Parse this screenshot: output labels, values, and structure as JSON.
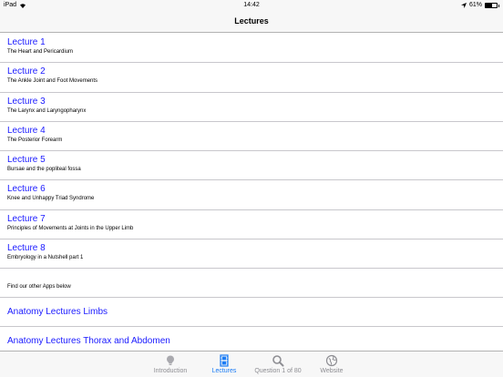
{
  "status": {
    "device": "iPad",
    "time": "14:42",
    "battery": "61%",
    "battery_level": 0.61
  },
  "nav": {
    "title": "Lectures"
  },
  "lectures": [
    {
      "title": "Lecture 1",
      "subtitle": "The Heart and Pericardium"
    },
    {
      "title": "Lecture 2",
      "subtitle": "The Ankle Joint and Foot Movements"
    },
    {
      "title": "Lecture 3",
      "subtitle": "The Larynx and Laryngopharynx"
    },
    {
      "title": "Lecture 4",
      "subtitle": "The Posterior Forearm"
    },
    {
      "title": "Lecture 5",
      "subtitle": "Bursae and the popliteal fossa"
    },
    {
      "title": "Lecture 6",
      "subtitle": "Knee and Unhappy Triad Syndrome"
    },
    {
      "title": "Lecture 7",
      "subtitle": "Principles of Movements at Joints in the Upper Limb"
    },
    {
      "title": "Lecture 8",
      "subtitle": "Embryology in a Nutshell part 1"
    }
  ],
  "other_apps": {
    "header": "Find our other Apps below",
    "items": [
      {
        "title": "Anatomy Lectures Limbs"
      },
      {
        "title": "Anatomy Lectures Thorax and Abdomen"
      }
    ]
  },
  "tabs": [
    {
      "label": "Introduction",
      "icon": "lightbulb-icon",
      "active": false
    },
    {
      "label": "Lectures",
      "icon": "film-icon",
      "active": true
    },
    {
      "label": "Question 1 of 80",
      "icon": "magnifier-icon",
      "active": false
    },
    {
      "label": "Website",
      "icon": "globe-icon",
      "active": false
    }
  ],
  "colors": {
    "link": "#1a1aff",
    "tab_active": "#1b7cf5",
    "tab_inactive": "#8e8e93"
  }
}
